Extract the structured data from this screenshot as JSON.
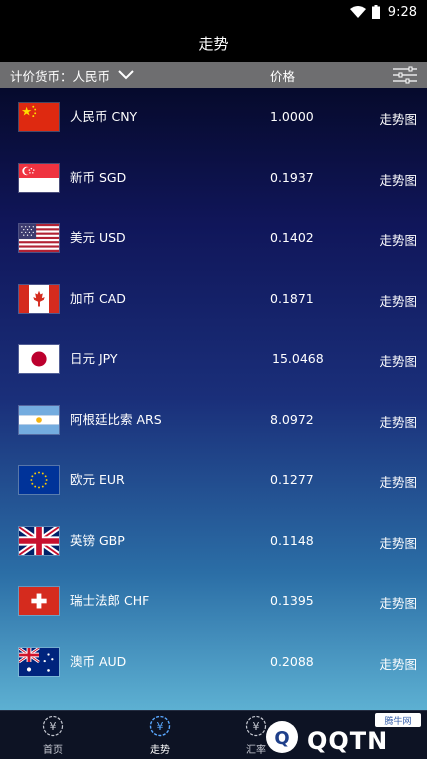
{
  "status_bar": {
    "time": "9:28"
  },
  "app_bar": {
    "title": "走势"
  },
  "header": {
    "currency_label": "计价货币：人民币",
    "price_label": "价格"
  },
  "rows": [
    {
      "flag": "china-flag",
      "name": "人民币 CNY",
      "value": "1.0000",
      "trend": "走势图"
    },
    {
      "flag": "singapore-flag",
      "name": "新币 SGD",
      "value": "0.1937",
      "trend": "走势图"
    },
    {
      "flag": "usa-flag",
      "name": "美元 USD",
      "value": "0.1402",
      "trend": "走势图"
    },
    {
      "flag": "canada-flag",
      "name": "加币 CAD",
      "value": "0.1871",
      "trend": "走势图"
    },
    {
      "flag": "japan-flag",
      "name": "日元 JPY",
      "value": "15.0468",
      "trend": "走势图"
    },
    {
      "flag": "argentina-flag",
      "name": "阿根廷比索 ARS",
      "value": "8.0972",
      "trend": "走势图"
    },
    {
      "flag": "eu-flag",
      "name": "欧元 EUR",
      "value": "0.1277",
      "trend": "走势图"
    },
    {
      "flag": "uk-flag",
      "name": "英镑 GBP",
      "value": "0.1148",
      "trend": "走势图"
    },
    {
      "flag": "switzerland-flag",
      "name": "瑞士法郎 CHF",
      "value": "0.1395",
      "trend": "走势图"
    },
    {
      "flag": "australia-flag",
      "name": "澳币 AUD",
      "value": "0.2088",
      "trend": "走势图"
    }
  ],
  "bottom_nav": [
    {
      "label": "首页",
      "icon": "yuan-circle-icon",
      "active": false
    },
    {
      "label": "走势",
      "icon": "yuan-circle-icon",
      "active": true
    },
    {
      "label": "汇率",
      "icon": "yuan-circle-icon",
      "active": false
    }
  ],
  "watermark": {
    "text": "QQTN",
    "badge": "腾牛网"
  }
}
